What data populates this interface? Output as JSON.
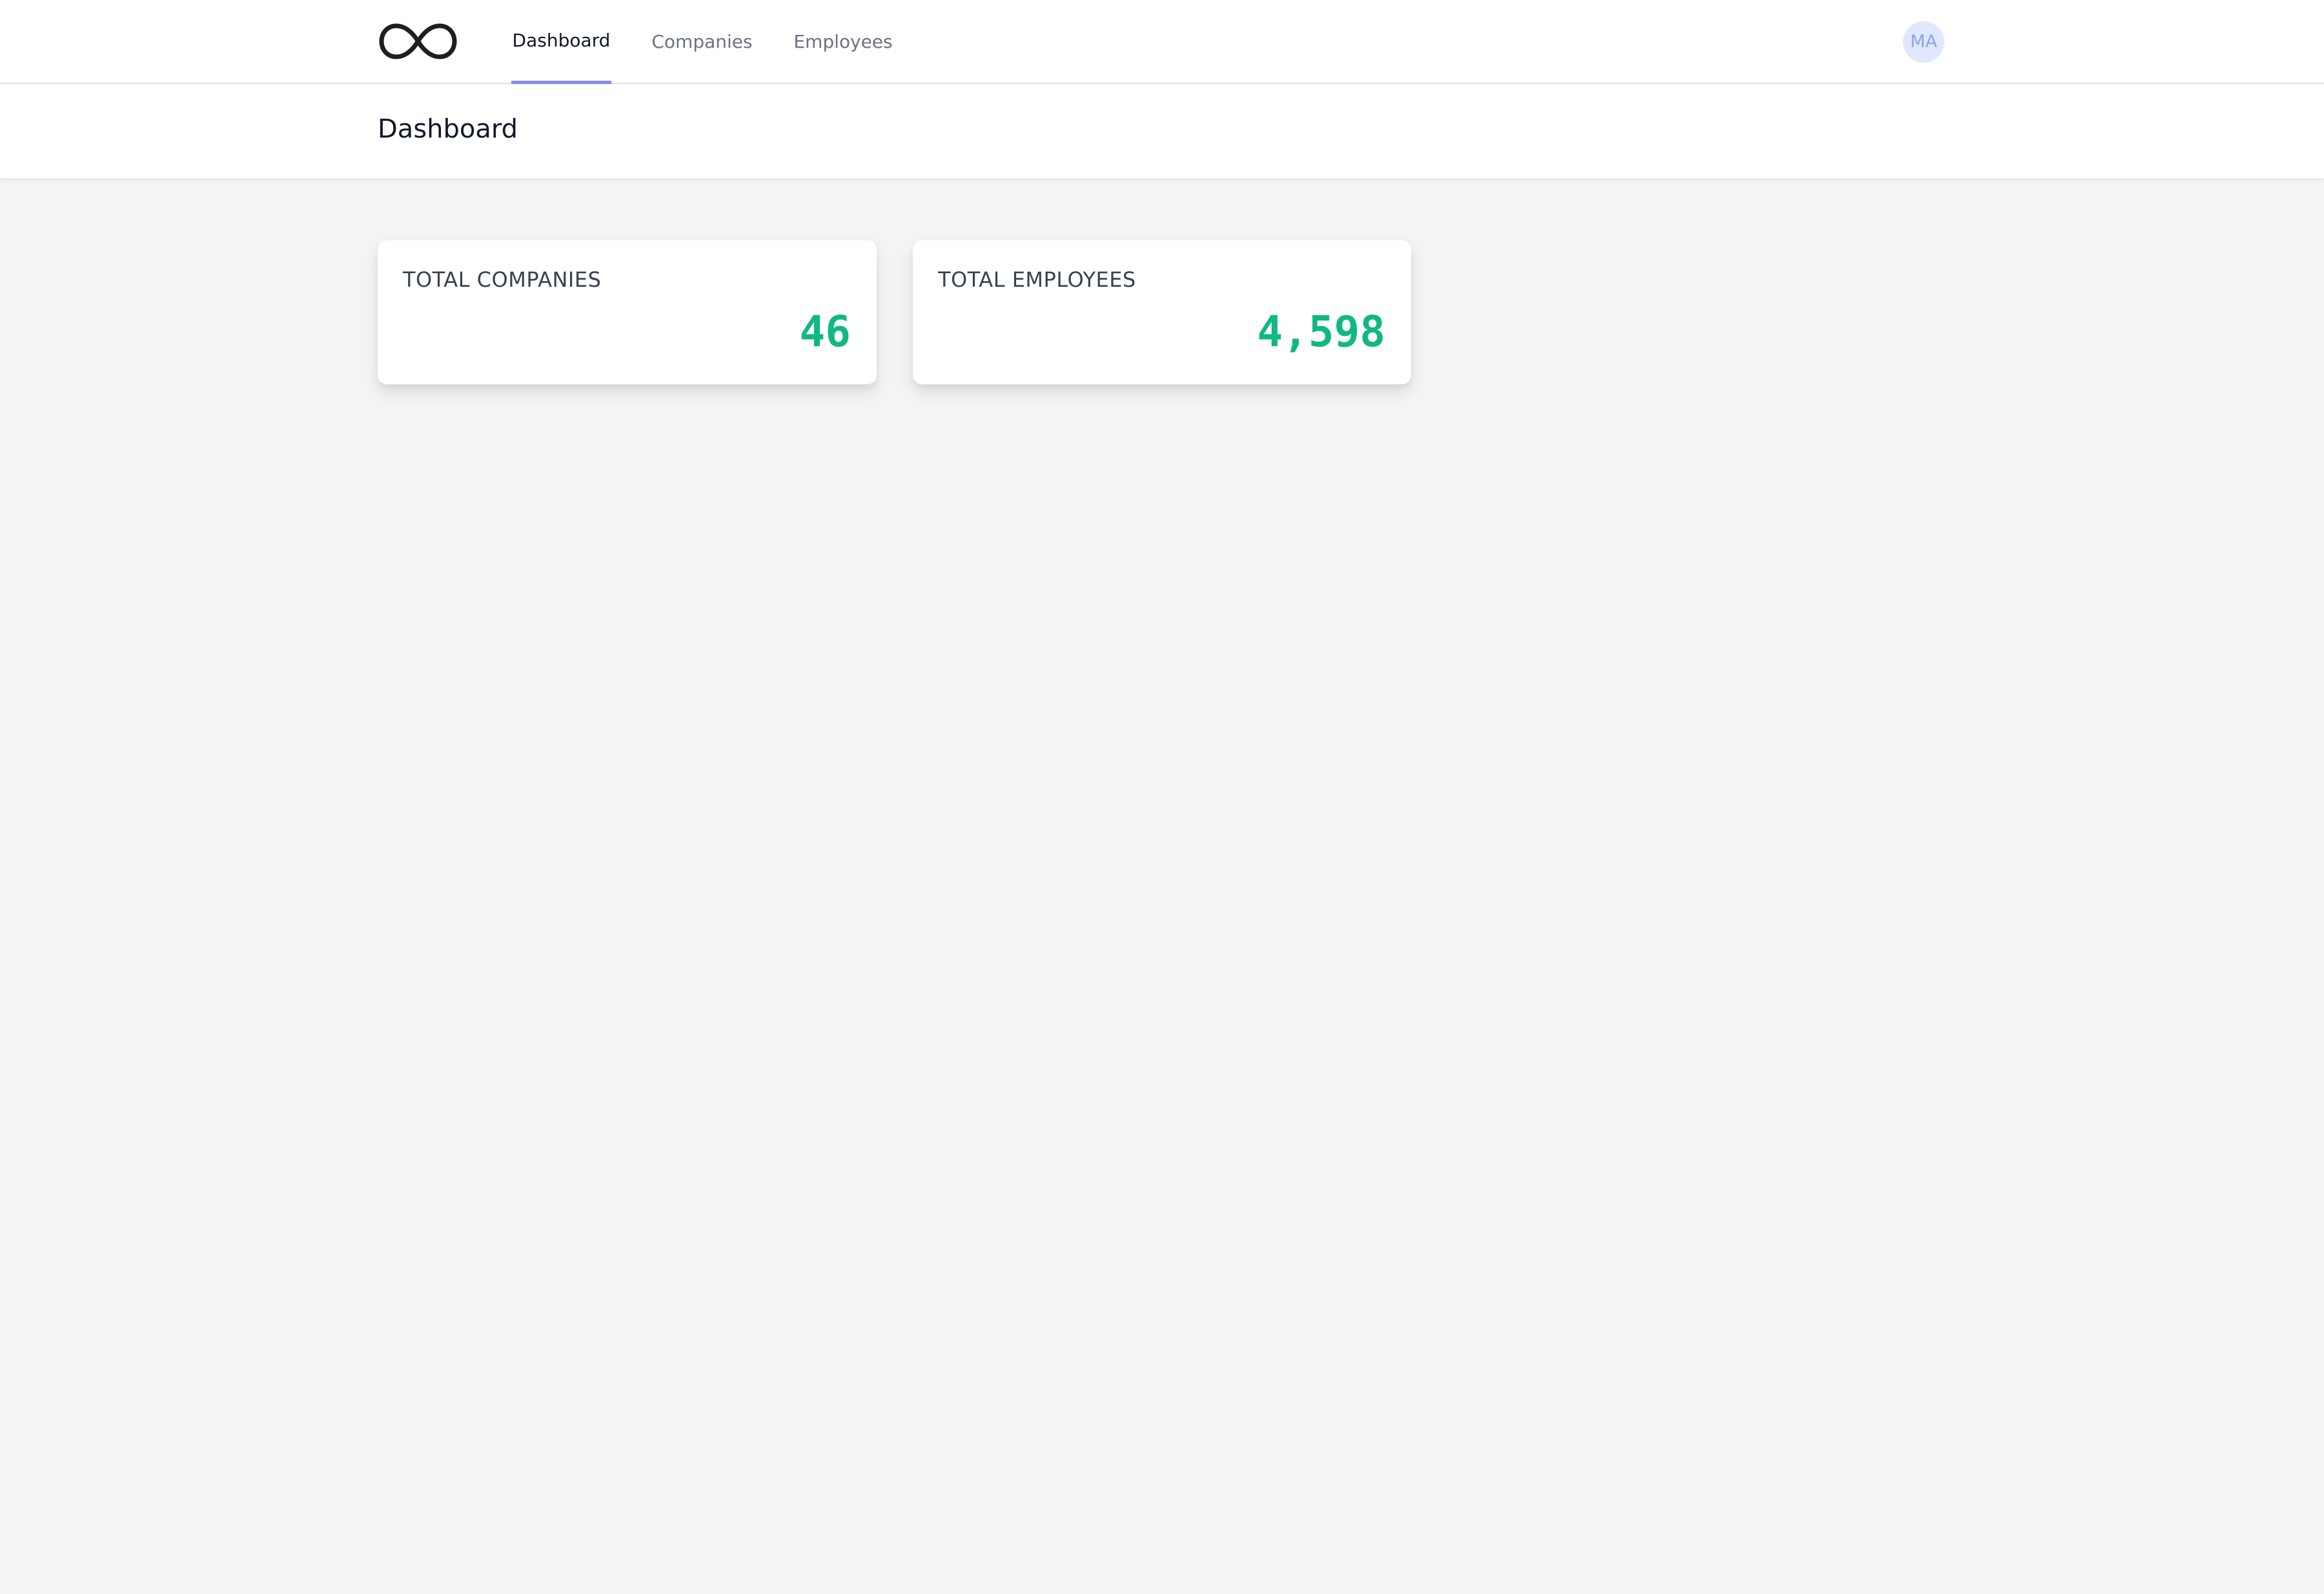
{
  "nav": {
    "logo_icon": "infinity-logo-icon",
    "links": [
      {
        "label": "Dashboard",
        "active": true
      },
      {
        "label": "Companies",
        "active": false
      },
      {
        "label": "Employees",
        "active": false
      }
    ],
    "avatar_initials": "MA"
  },
  "header": {
    "title": "Dashboard"
  },
  "stats": [
    {
      "label": "TOTAL COMPANIES",
      "value": "46"
    },
    {
      "label": "TOTAL EMPLOYEES",
      "value": "4,598"
    }
  ],
  "colors": {
    "background": "#f3f4f6",
    "active_underline": "#818cf8",
    "stat_value": "#10b981",
    "avatar_bg": "#e0e7ff",
    "avatar_text": "#8ba3e6"
  }
}
